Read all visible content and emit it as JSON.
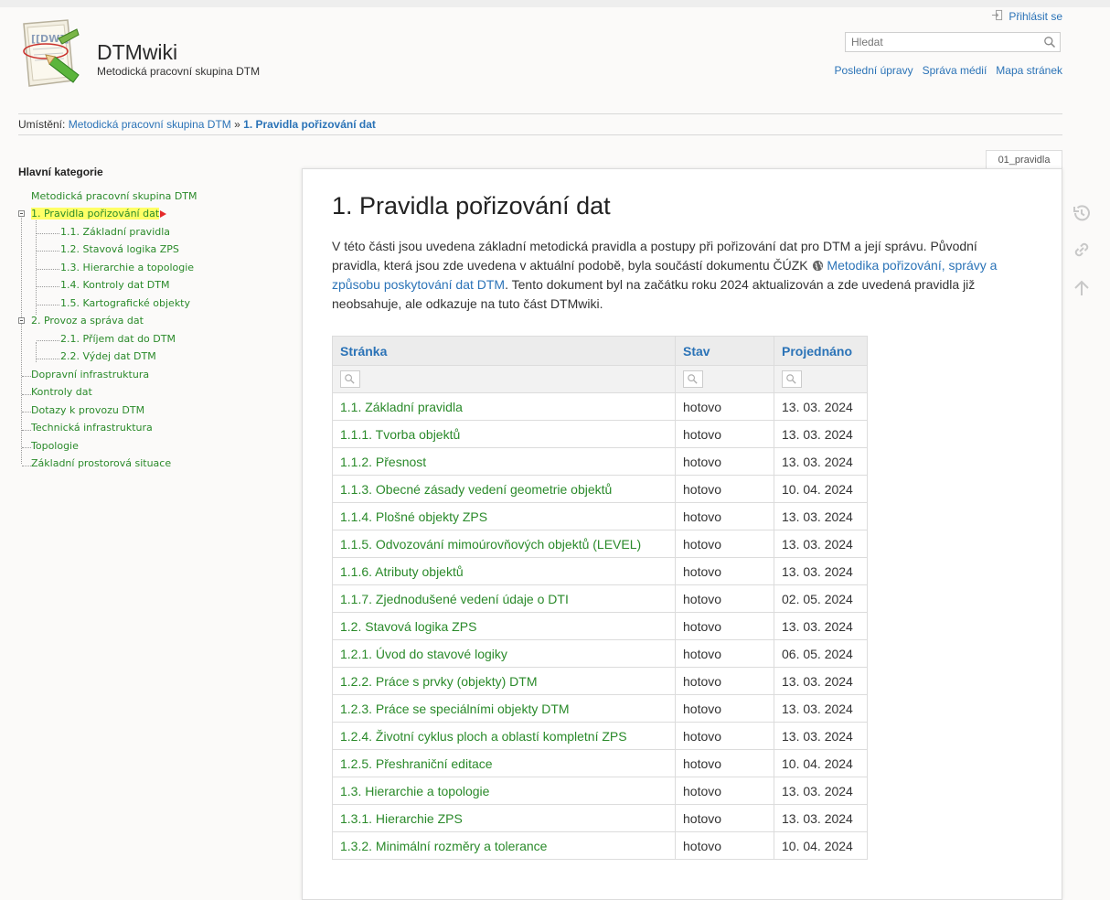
{
  "header": {
    "site_title": "DTMwiki",
    "tagline": "Metodická pracovní skupina DTM",
    "login": "Přihlásit se",
    "search_placeholder": "Hledat",
    "tools": [
      "Poslední úpravy",
      "Správa médií",
      "Mapa stránek"
    ]
  },
  "breadcrumb": {
    "label": "Umístění:",
    "root": "Metodická pracovní skupina DTM",
    "sep": "»",
    "current": "1. Pravidla pořizování dat"
  },
  "sidebar": {
    "title": "Hlavní kategorie",
    "items": [
      {
        "label": "Metodická pracovní skupina DTM"
      },
      {
        "label": "1. Pravidla pořizování dat"
      },
      {
        "label": "1.1. Základní pravidla"
      },
      {
        "label": "1.2. Stavová logika ZPS"
      },
      {
        "label": "1.3. Hierarchie a topologie"
      },
      {
        "label": "1.4. Kontroly dat DTM"
      },
      {
        "label": "1.5. Kartografické objekty"
      },
      {
        "label": "2. Provoz a správa dat"
      },
      {
        "label": "2.1. Příjem dat do DTM"
      },
      {
        "label": "2.2. Výdej dat DTM"
      },
      {
        "label": "Dopravní infrastruktura"
      },
      {
        "label": "Kontroly dat"
      },
      {
        "label": "Dotazy k provozu DTM"
      },
      {
        "label": "Technická infrastruktura"
      },
      {
        "label": "Topologie"
      },
      {
        "label": "Základní prostorová situace"
      }
    ]
  },
  "page": {
    "tab": "01_pravidla",
    "title": "1. Pravidla pořizování dat",
    "intro_1": "V této části jsou uvedena základní metodická pravidla a postupy při pořizování dat pro DTM a její správu. Původní pravidla, která jsou zde uvedena v aktuální podobě, byla součástí dokumentu ČÚZK ",
    "intro_link": "Metodika pořizování, správy a způsobu poskytování dat DTM",
    "intro_2": ". Tento dokument byl na začátku roku 2024 aktualizován a zde uvedená pravidla již neobsahuje, ale odkazuje na tuto část DTMwiki."
  },
  "table": {
    "headers": [
      "Stránka",
      "Stav",
      "Projednáno"
    ],
    "rows": [
      [
        "1.1. Základní pravidla",
        "hotovo",
        "13. 03. 2024"
      ],
      [
        "1.1.1. Tvorba objektů",
        "hotovo",
        "13. 03. 2024"
      ],
      [
        "1.1.2. Přesnost",
        "hotovo",
        "13. 03. 2024"
      ],
      [
        "1.1.3. Obecné zásady vedení geometrie objektů",
        "hotovo",
        "10. 04. 2024"
      ],
      [
        "1.1.4. Plošné objekty ZPS",
        "hotovo",
        "13. 03. 2024"
      ],
      [
        "1.1.5. Odvozování mimoúrovňových objektů (LEVEL)",
        "hotovo",
        "13. 03. 2024"
      ],
      [
        "1.1.6. Atributy objektů",
        "hotovo",
        "13. 03. 2024"
      ],
      [
        "1.1.7. Zjednodušené vedení údaje o DTI",
        "hotovo",
        "02. 05. 2024"
      ],
      [
        "1.2. Stavová logika ZPS",
        "hotovo",
        "13. 03. 2024"
      ],
      [
        "1.2.1. Úvod do stavové logiky",
        "hotovo",
        "06. 05. 2024"
      ],
      [
        "1.2.2. Práce s prvky (objekty) DTM",
        "hotovo",
        "13. 03. 2024"
      ],
      [
        "1.2.3. Práce se speciálními objekty DTM",
        "hotovo",
        "13. 03. 2024"
      ],
      [
        "1.2.4. Životní cyklus ploch a oblastí kompletní ZPS",
        "hotovo",
        "13. 03. 2024"
      ],
      [
        "1.2.5. Přeshraniční editace",
        "hotovo",
        "10. 04. 2024"
      ],
      [
        "1.3. Hierarchie a topologie",
        "hotovo",
        "13. 03. 2024"
      ],
      [
        "1.3.1. Hierarchie ZPS",
        "hotovo",
        "13. 03. 2024"
      ],
      [
        "1.3.2. Minimální rozměry a tolerance",
        "hotovo",
        "10. 04. 2024"
      ]
    ]
  }
}
